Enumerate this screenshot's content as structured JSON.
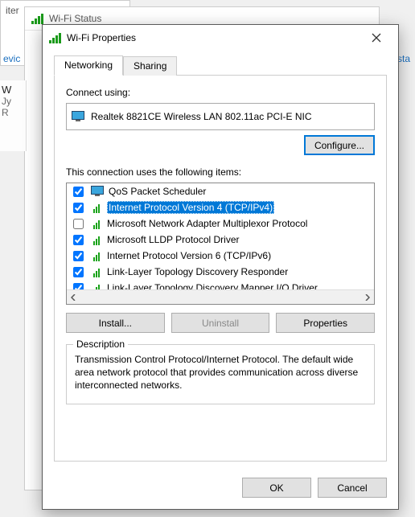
{
  "bg": {
    "window1_title_fragment": "iter",
    "window2_title": "Wi-Fi Status",
    "left_frag1": "evic",
    "left_frag2": "W",
    "left_frag3": "Jy",
    "left_frag4": "R",
    "right_frag": "sta"
  },
  "dialog": {
    "title": "Wi-Fi Properties"
  },
  "tabs": {
    "networking": "Networking",
    "sharing": "Sharing"
  },
  "connect": {
    "label": "Connect using:",
    "adapter": "Realtek 8821CE Wireless LAN 802.11ac PCI-E NIC",
    "configure_btn": "Configure..."
  },
  "items_label": "This connection uses the following items:",
  "items": [
    {
      "checked": true,
      "label": "QoS Packet Scheduler",
      "icon": "qos"
    },
    {
      "checked": true,
      "label": "Internet Protocol Version 4 (TCP/IPv4)",
      "icon": "net",
      "selected": true
    },
    {
      "checked": false,
      "label": "Microsoft Network Adapter Multiplexor Protocol",
      "icon": "net"
    },
    {
      "checked": true,
      "label": "Microsoft LLDP Protocol Driver",
      "icon": "net"
    },
    {
      "checked": true,
      "label": "Internet Protocol Version 6 (TCP/IPv6)",
      "icon": "net"
    },
    {
      "checked": true,
      "label": "Link-Layer Topology Discovery Responder",
      "icon": "net"
    },
    {
      "checked": true,
      "label": "Link-Layer Topology Discovery Mapper I/O Driver",
      "icon": "net"
    }
  ],
  "buttons": {
    "install": "Install...",
    "uninstall": "Uninstall",
    "properties": "Properties",
    "ok": "OK",
    "cancel": "Cancel"
  },
  "description": {
    "legend": "Description",
    "text": "Transmission Control Protocol/Internet Protocol. The default wide area network protocol that provides communication across diverse interconnected networks."
  }
}
